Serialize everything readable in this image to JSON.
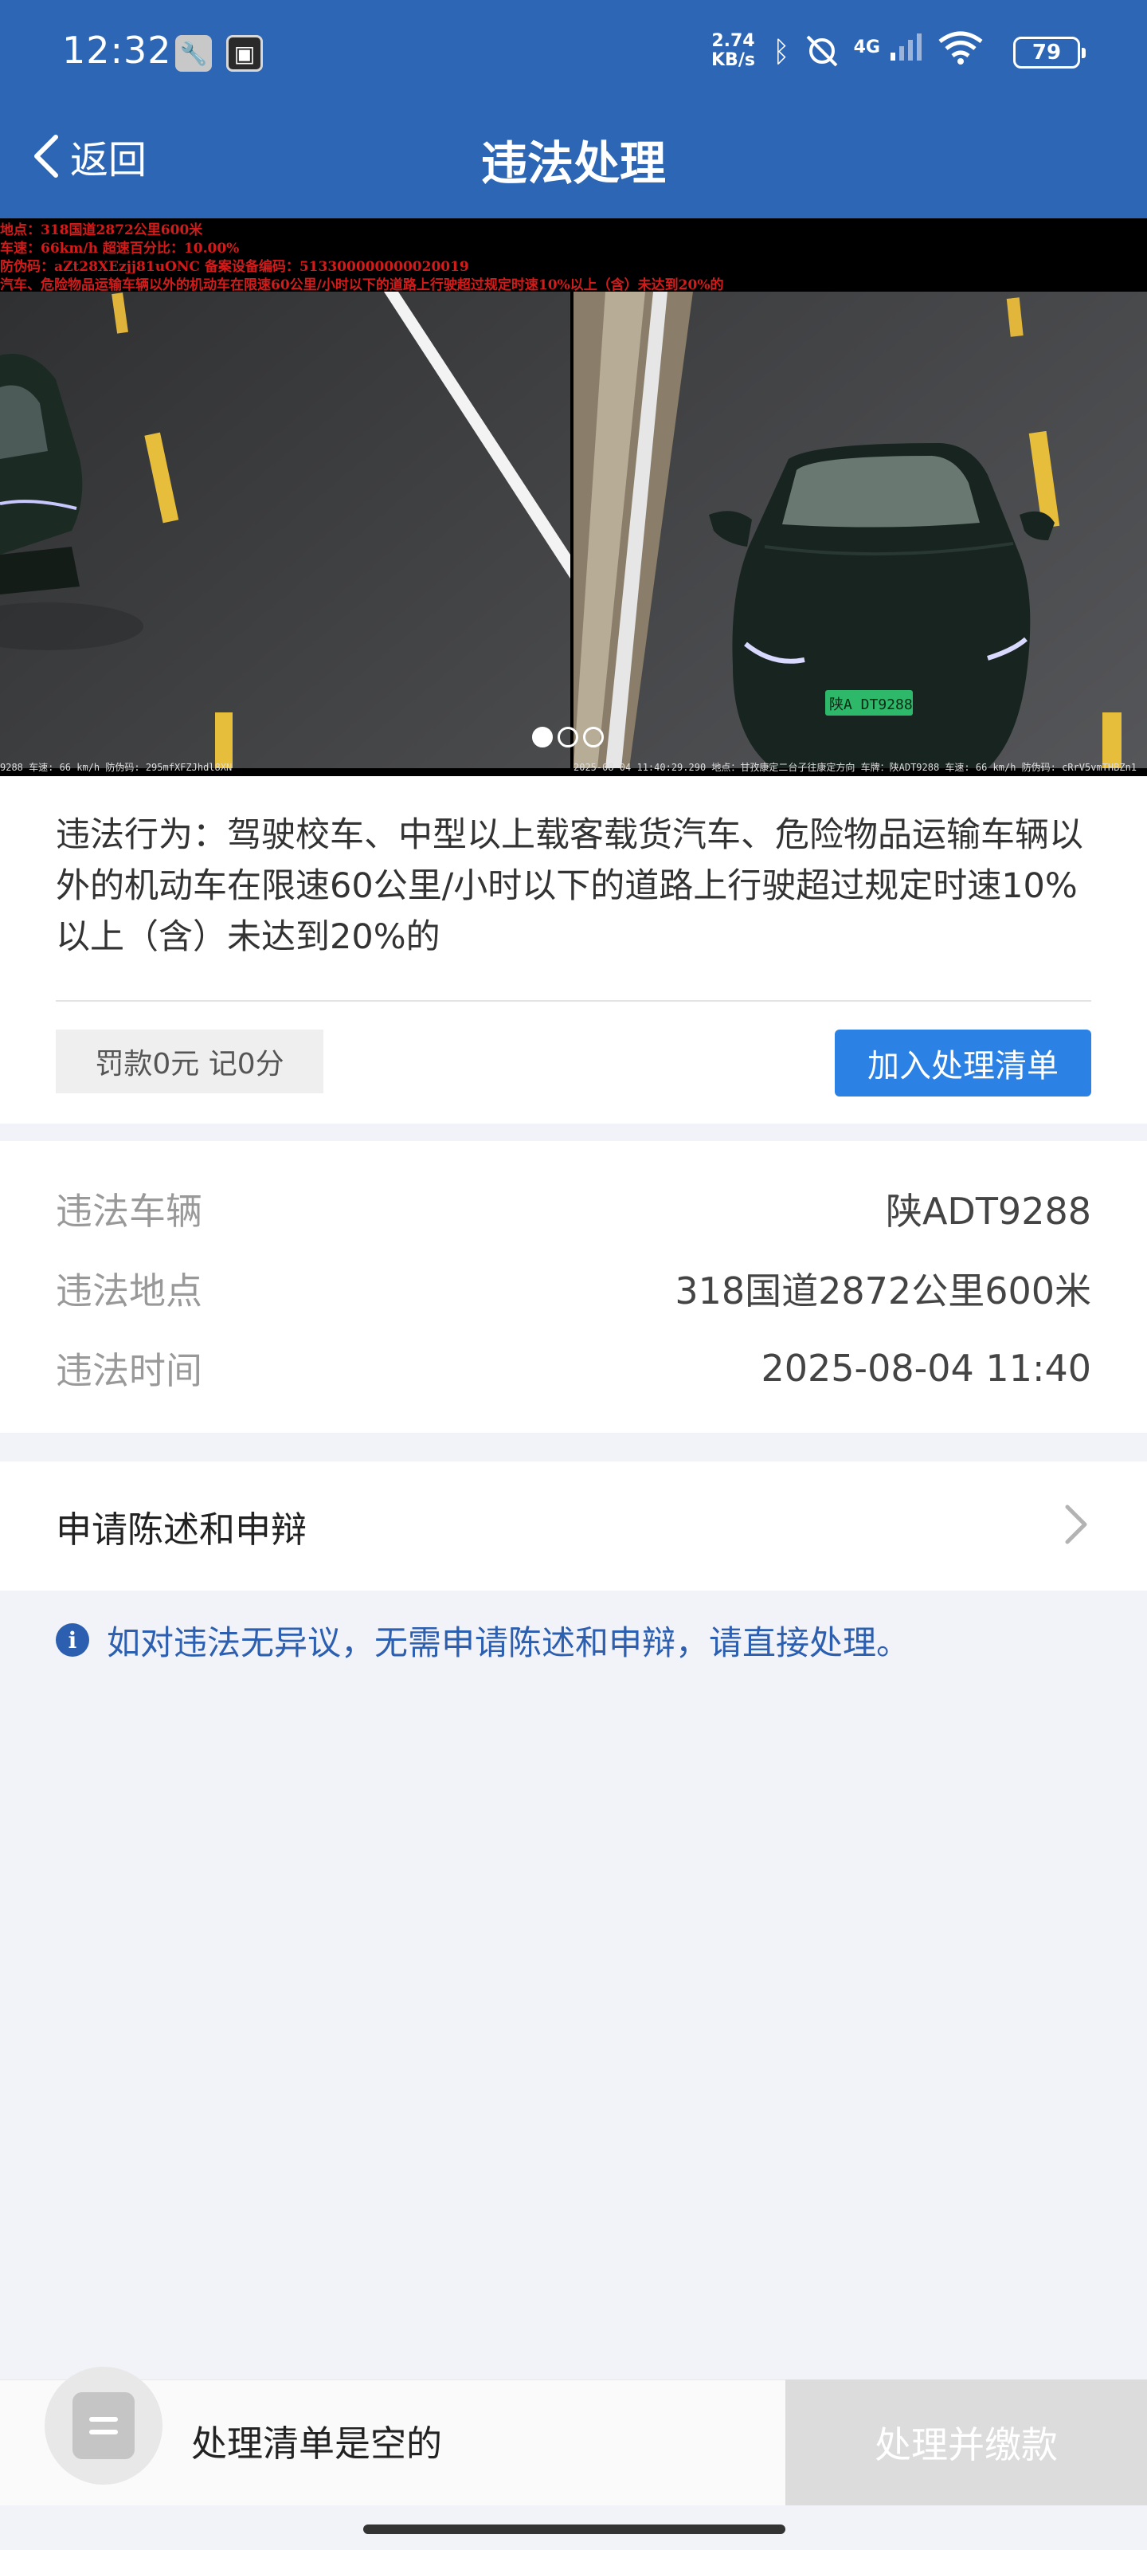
{
  "status_bar": {
    "time": "12:32",
    "net_speed_value": "2.74",
    "net_speed_unit": "KB/s",
    "network_type": "4G",
    "battery": "79"
  },
  "header": {
    "back_label": "返回",
    "title": "违法处理"
  },
  "photo": {
    "caption_lines": [
      "地点：318国道2872公里600米",
      "车速：66km/h   超速百分比：10.00%",
      "防伪码：aZt28XEzjj81uONC   备案设备编码：513300000000020019",
      "汽车、危险物品运输车辆以外的机动车在限速60公里/小时以下的道路上行驶超过规定时速10%以上（含）未达到20%的"
    ],
    "footer_left": "9288 车速: 66 km/h 防伪码: 295mfXFZJhdl8XN",
    "footer_right": "2025-08-04 11:40:29.290 地点：甘孜康定二台子往康定方向 车牌：陕ADT9288 车速: 66 km/h 防伪码: cRrV5vmTHBZn1",
    "plate_on_car": "陕A DT9288",
    "total_photos": 3,
    "active_photo_index": 0
  },
  "violation": {
    "behavior_label": "违法行为：",
    "behavior_text": "驾驶校车、中型以上载客载货汽车、危险物品运输车辆以外的机动车在限速60公里/小时以下的道路上行驶超过规定时速10%以上（含）未达到20%的",
    "penalty": "罚款0元 记0分",
    "add_button": "加入处理清单"
  },
  "details": [
    {
      "label": "违法车辆",
      "value": "陕ADT9288"
    },
    {
      "label": "违法地点",
      "value": "318国道2872公里600米"
    },
    {
      "label": "违法时间",
      "value": "2025-08-04 11:40"
    }
  ],
  "appeal": {
    "label": "申请陈述和申辩"
  },
  "notice": {
    "icon_glyph": "i",
    "text": "如对违法无异议，无需申请陈述和申辩，请直接处理。"
  },
  "bottom": {
    "empty_text": "处理清单是空的",
    "pay_button": "处理并缴款"
  },
  "colors": {
    "header_bg": "#2d66b5",
    "primary_button": "#2b81e4",
    "notice_text": "#2c5fb0",
    "disabled_button": "#dcdcdc"
  }
}
